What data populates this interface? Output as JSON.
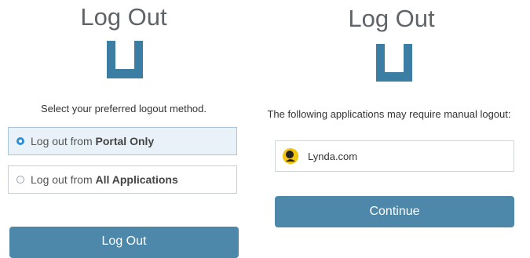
{
  "colors": {
    "brand": "#4d87a9",
    "title_text": "#5f6468",
    "radio_selected": "#2e8fd6",
    "selected_option_bg": "#e8f2f8"
  },
  "left_panel": {
    "title": "Log Out",
    "logo_icon": "u-logo-icon",
    "instruction": "Select your preferred logout method.",
    "options": [
      {
        "prefix": "Log out from ",
        "emphasis": "Portal Only",
        "selected": true
      },
      {
        "prefix": "Log out from ",
        "emphasis": "All Applications",
        "selected": false
      }
    ],
    "logout_button": "Log Out"
  },
  "right_panel": {
    "title": "Log Out",
    "logo_icon": "u-logo-icon",
    "message": "The following applications may require manual logout:",
    "applications": [
      {
        "name": "Lynda.com",
        "icon": "lynda-icon"
      }
    ],
    "continue_button": "Continue"
  }
}
